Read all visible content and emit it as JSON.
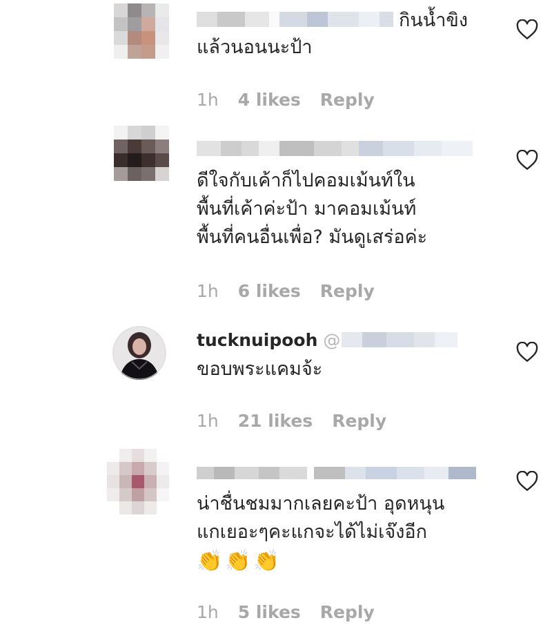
{
  "comments": [
    {
      "username": "",
      "text_inline": "กินน้ำขิง",
      "text_lines": [
        "แล้วนอนนะป้า"
      ],
      "time": "1h",
      "likes": "4 likes",
      "reply": "Reply"
    },
    {
      "username": "",
      "text_lines": [
        "ดีใจกับเค้าก็ไปคอมเม้นท์ใน",
        "พื้นที่เค้าค่ะป้า มาคอมเม้นท์",
        "พื้นที่คนอื่นเพื่อ? มันดูเสร่อค่ะ"
      ],
      "time": "1h",
      "likes": "6 likes",
      "reply": "Reply"
    },
    {
      "username": "tucknuipooh",
      "mention_prefix": "@",
      "text_lines": [
        "ขอบพระแคมจ้ะ"
      ],
      "time": "1h",
      "likes": "21 likes",
      "reply": "Reply"
    },
    {
      "username": "",
      "text_lines": [
        "น่าชื่นชมมากเลยคะป้า อุดหนุน",
        "แกเยอะๆคะแกจะได้ไม่เจ๊งอีก"
      ],
      "emoji": "👏👏👏",
      "time": "1h",
      "likes": "5 likes",
      "reply": "Reply"
    }
  ],
  "colors": {
    "text": "#262626",
    "meta": "#a8a8a8",
    "heart_stroke": "#262626"
  },
  "icons": {
    "like": "heart-outline-icon",
    "avatar_blur": "pixelated-avatar"
  }
}
